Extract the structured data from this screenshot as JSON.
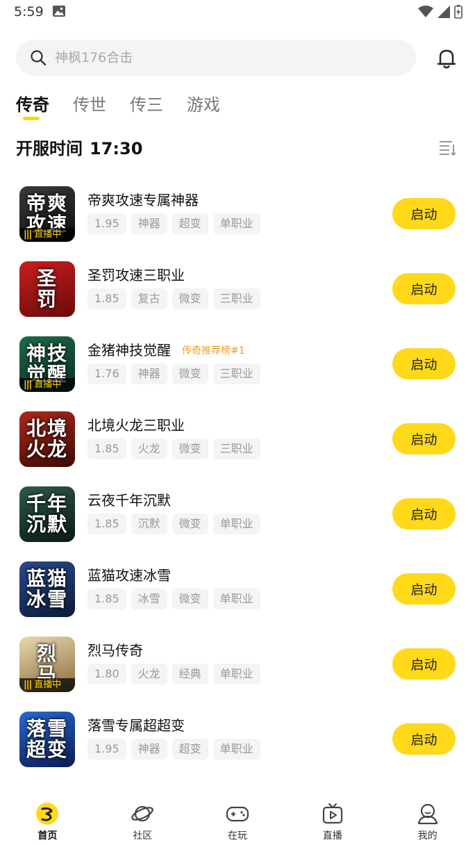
{
  "status_bar": {
    "time": "5:59"
  },
  "search": {
    "placeholder": "神枫176合击"
  },
  "tabs": [
    {
      "label": "传奇",
      "active": true
    },
    {
      "label": "传世",
      "active": false
    },
    {
      "label": "传三",
      "active": false
    },
    {
      "label": "游戏",
      "active": false
    }
  ],
  "section": {
    "label": "开服时间",
    "time": "17:30"
  },
  "games": [
    {
      "name": "帝爽攻速专属神器",
      "icon_text": "帝爽\n攻速",
      "icon_colors": [
        "#3a3a3a",
        "#0d0d0d"
      ],
      "live_label": "直播中",
      "rank": "",
      "tags": [
        "1.95",
        "神器",
        "超变",
        "单职业"
      ],
      "button": "启动"
    },
    {
      "name": "圣罚攻速三职业",
      "icon_text": "圣\n罚",
      "icon_colors": [
        "#c81e1e",
        "#6b0a0a"
      ],
      "live_label": "",
      "rank": "",
      "tags": [
        "1.85",
        "复古",
        "微变",
        "三职业"
      ],
      "button": "启动"
    },
    {
      "name": "金猪神技觉醒",
      "icon_text": "神技\n觉醒",
      "icon_colors": [
        "#1f6b4a",
        "#0b2a20"
      ],
      "live_label": "直播中",
      "rank": "传奇推荐榜#1",
      "tags": [
        "1.76",
        "神器",
        "微变",
        "三职业"
      ],
      "button": "启动"
    },
    {
      "name": "北境火龙三职业",
      "icon_text": "北境\n火龙",
      "icon_colors": [
        "#b0281a",
        "#3a0a06"
      ],
      "live_label": "",
      "rank": "",
      "tags": [
        "1.85",
        "火龙",
        "微变",
        "三职业"
      ],
      "button": "启动"
    },
    {
      "name": "云夜千年沉默",
      "icon_text": "千年\n沉默",
      "icon_colors": [
        "#2d5a48",
        "#0a1a14"
      ],
      "live_label": "",
      "rank": "",
      "tags": [
        "1.85",
        "沉默",
        "微变",
        "单职业"
      ],
      "button": "启动"
    },
    {
      "name": "蓝猫攻速冰雪",
      "icon_text": "蓝猫\n冰雪",
      "icon_colors": [
        "#2a4a8a",
        "#0c1a3a"
      ],
      "live_label": "",
      "rank": "",
      "tags": [
        "1.85",
        "冰雪",
        "微变",
        "单职业"
      ],
      "button": "启动"
    },
    {
      "name": "烈马传奇",
      "icon_text": "烈\n马",
      "icon_colors": [
        "#e8d8b0",
        "#8a6a3a"
      ],
      "live_label": "直播中",
      "rank": "",
      "tags": [
        "1.80",
        "火龙",
        "经典",
        "单职业"
      ],
      "button": "启动"
    },
    {
      "name": "落雪专属超超变",
      "icon_text": "落雪\n超变",
      "icon_colors": [
        "#2a6ad0",
        "#0a1a50"
      ],
      "live_label": "",
      "rank": "",
      "tags": [
        "1.95",
        "神器",
        "超变",
        "单职业"
      ],
      "button": "启动"
    }
  ],
  "nav": [
    {
      "label": "首页",
      "icon": "home-icon",
      "active": true
    },
    {
      "label": "社区",
      "icon": "planet-icon",
      "active": false
    },
    {
      "label": "在玩",
      "icon": "gamepad-icon",
      "active": false
    },
    {
      "label": "直播",
      "icon": "tv-icon",
      "active": false
    },
    {
      "label": "我的",
      "icon": "user-icon",
      "active": false
    }
  ],
  "colors": {
    "accent": "#ffd91a",
    "rank": "#f0a020",
    "tag_bg": "#f4f4f4"
  }
}
